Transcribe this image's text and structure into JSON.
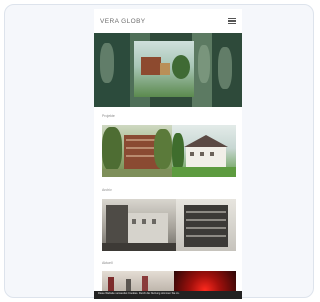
{
  "site": {
    "brand": "VERA GLOBY",
    "menu_icon": "hamburger-menu-icon"
  },
  "sections": [
    {
      "label": "Projekte"
    },
    {
      "label": "Archiv"
    },
    {
      "label": "Aktuell"
    }
  ],
  "cookie_banner": {
    "text": "Diese Website verwendet Cookies. Durch die Nutzung stimmen Sie zu."
  },
  "colors": {
    "accent_green": "#2f4a3a",
    "text_muted": "#6e6e6e",
    "card_background": "#f5f7fb"
  }
}
